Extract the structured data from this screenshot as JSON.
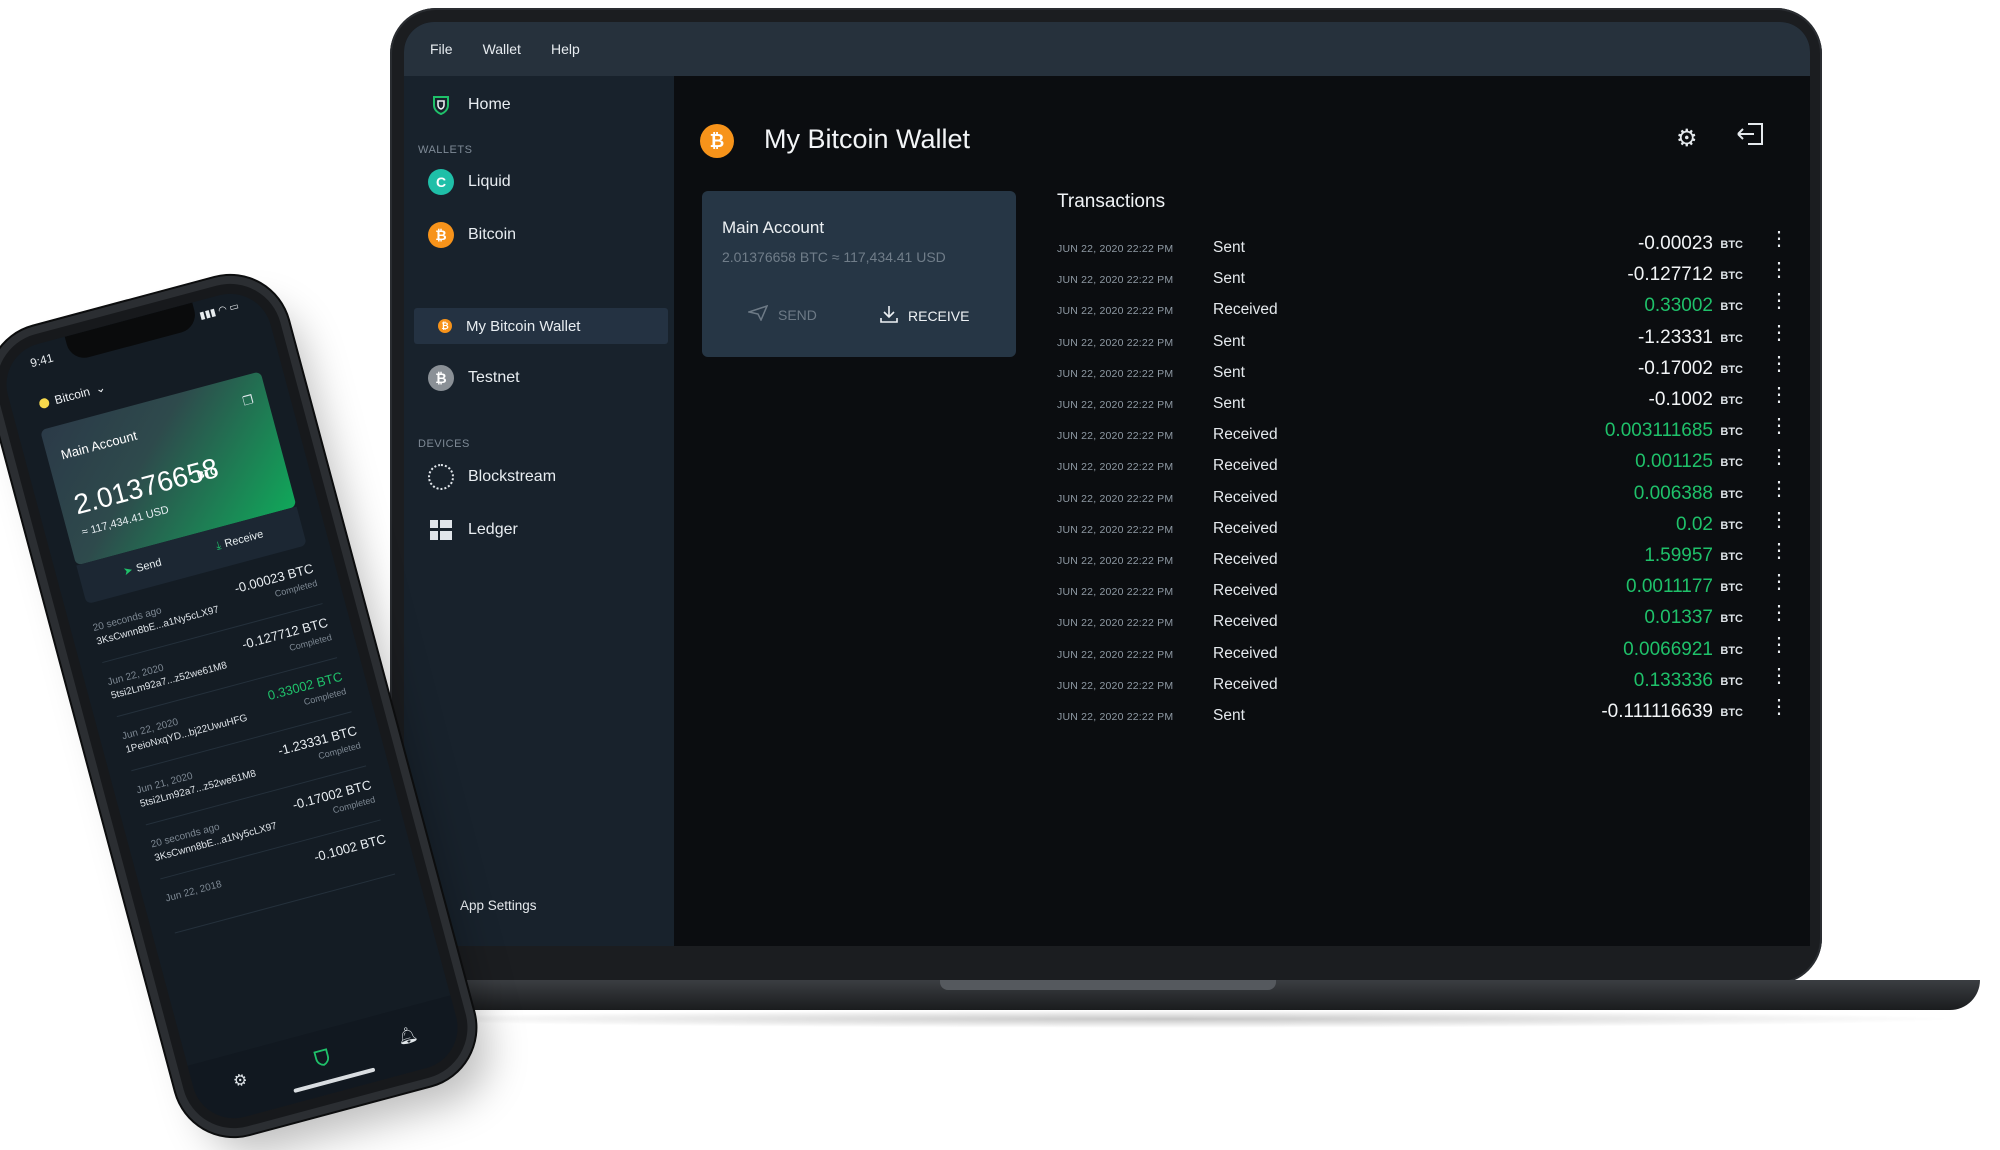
{
  "menubar": {
    "items": [
      "File",
      "Wallet",
      "Help"
    ]
  },
  "sidebar": {
    "home": "Home",
    "wallets_heading": "WALLETS",
    "wallets": [
      {
        "label": "Liquid",
        "icon": "liquid-icon",
        "color": "#1fbfa8"
      },
      {
        "label": "Bitcoin",
        "icon": "bitcoin-icon",
        "color": "#f7931a"
      },
      {
        "label": "My Bitcoin Wallet",
        "icon": "bitcoin-icon",
        "color": "#f7931a",
        "selected": true
      },
      {
        "label": "Testnet",
        "icon": "testnet-icon",
        "color": "#8a9096"
      }
    ],
    "devices_heading": "DEVICES",
    "devices": [
      {
        "label": "Blockstream",
        "icon": "blockstream-jade-icon"
      },
      {
        "label": "Ledger",
        "icon": "ledger-icon"
      }
    ],
    "app_settings": "App Settings"
  },
  "header": {
    "title": "My Bitcoin Wallet"
  },
  "account_card": {
    "name": "Main Account",
    "balance": "2.01376658 BTC ≈ 117,434.41 USD",
    "send": "SEND",
    "receive": "RECEIVE"
  },
  "transactions": {
    "title": "Transactions",
    "unit": "BTC",
    "rows": [
      {
        "date": "JUN 22, 2020 22:22 PM",
        "type": "Sent",
        "amount": "-0.00023"
      },
      {
        "date": "JUN 22, 2020 22:22 PM",
        "type": "Sent",
        "amount": "-0.127712"
      },
      {
        "date": "JUN 22, 2020 22:22 PM",
        "type": "Received",
        "amount": "0.33002"
      },
      {
        "date": "JUN 22, 2020 22:22 PM",
        "type": "Sent",
        "amount": "-1.23331"
      },
      {
        "date": "JUN 22, 2020 22:22 PM",
        "type": "Sent",
        "amount": "-0.17002"
      },
      {
        "date": "JUN 22, 2020 22:22 PM",
        "type": "Sent",
        "amount": "-0.1002"
      },
      {
        "date": "JUN 22, 2020 22:22 PM",
        "type": "Received",
        "amount": "0.003111685"
      },
      {
        "date": "JUN 22, 2020 22:22 PM",
        "type": "Received",
        "amount": "0.001125"
      },
      {
        "date": "JUN 22, 2020 22:22 PM",
        "type": "Received",
        "amount": "0.006388"
      },
      {
        "date": "JUN 22, 2020 22:22 PM",
        "type": "Received",
        "amount": "0.02"
      },
      {
        "date": "JUN 22, 2020 22:22 PM",
        "type": "Received",
        "amount": "1.59957"
      },
      {
        "date": "JUN 22, 2020 22:22 PM",
        "type": "Received",
        "amount": "0.0011177"
      },
      {
        "date": "JUN 22, 2020 22:22 PM",
        "type": "Received",
        "amount": "0.01337"
      },
      {
        "date": "JUN 22, 2020 22:22 PM",
        "type": "Received",
        "amount": "0.0066921"
      },
      {
        "date": "JUN 22, 2020 22:22 PM",
        "type": "Received",
        "amount": "0.133336"
      },
      {
        "date": "JUN 22, 2020 22:22 PM",
        "type": "Sent",
        "amount": "-0.111116639"
      }
    ]
  },
  "phone": {
    "time": "9:41",
    "network": "Bitcoin",
    "card": {
      "title": "Main Account",
      "balance": "2.01376658",
      "unit": "BTC",
      "fiat": "≈ 117,434.41 USD"
    },
    "send": "Send",
    "receive": "Receive",
    "transactions": [
      {
        "date": "20 seconds ago",
        "address": "3KsCwnn8bE...a1Ny5cLX97",
        "amount": "-0.00023 BTC",
        "status": "Completed",
        "green": false
      },
      {
        "date": "Jun 22, 2020",
        "address": "5tsi2Lm92a7...z52we61M8",
        "amount": "-0.127712 BTC",
        "status": "Completed",
        "green": false
      },
      {
        "date": "Jun 22, 2020",
        "address": "1PeioNxqYD...bj22UwuHFG",
        "amount": "0.33002 BTC",
        "status": "Completed",
        "green": true
      },
      {
        "date": "Jun 21, 2020",
        "address": "5tsi2Lm92a7...z52we61M8",
        "amount": "-1.23331 BTC",
        "status": "Completed",
        "green": false
      },
      {
        "date": "20 seconds ago",
        "address": "3KsCwnn8bE...a1Ny5cLX97",
        "amount": "-0.17002 BTC",
        "status": "Completed",
        "green": false
      },
      {
        "date": "Jun 22, 2018",
        "address": "",
        "amount": "-0.1002 BTC",
        "status": "",
        "green": false
      }
    ]
  },
  "colors": {
    "accent_green": "#1fc16a",
    "bitcoin_orange": "#f7931a",
    "sidebar_bg": "#18222c",
    "menubar_bg": "#26313c"
  }
}
